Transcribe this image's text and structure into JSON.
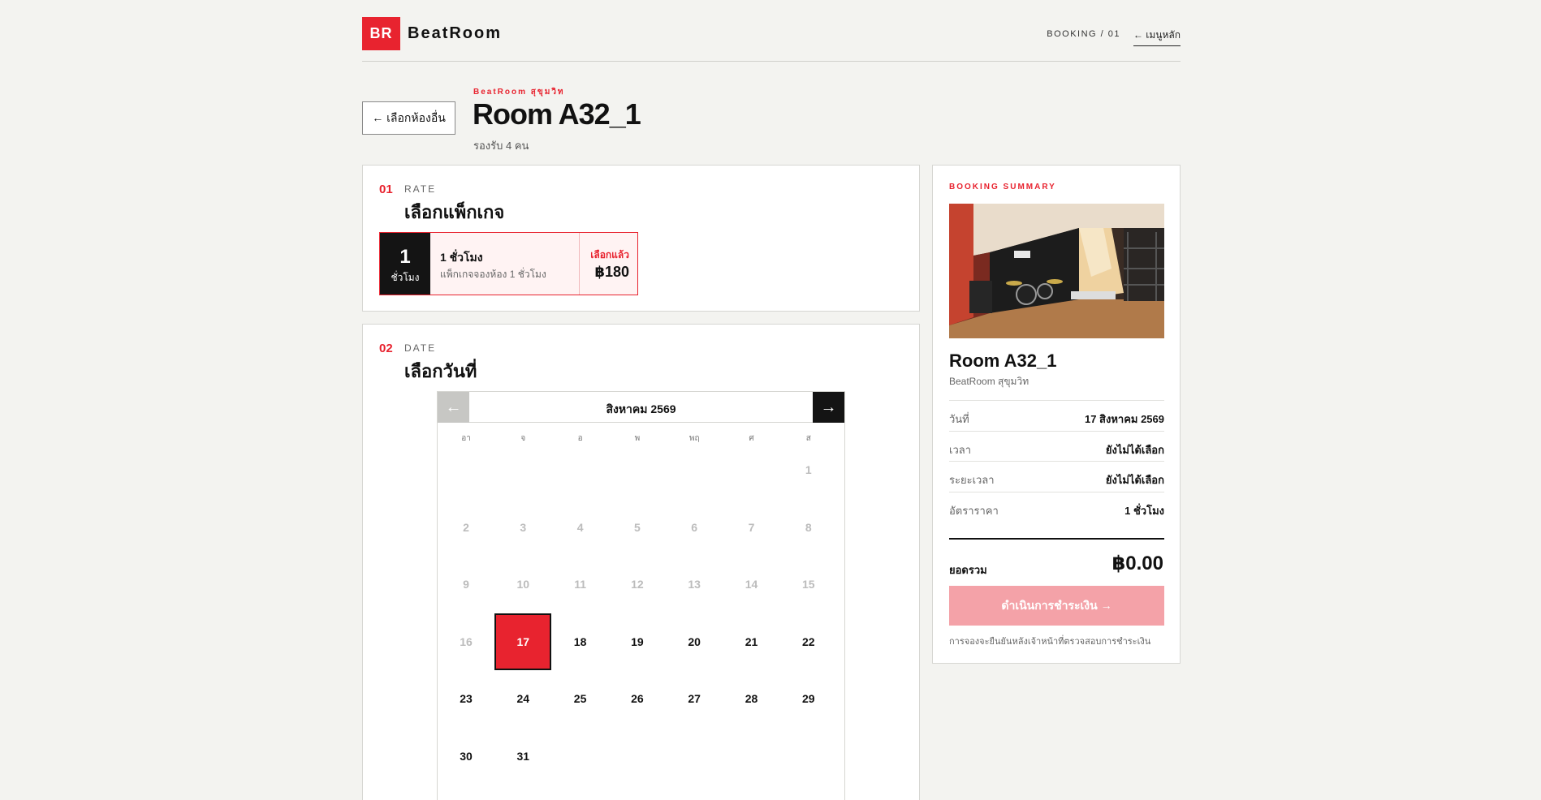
{
  "header": {
    "logo": "BR",
    "brand": "BeatRoom",
    "breadcrumb": "BOOKING / 01",
    "home_link": "← เมนูหลัก"
  },
  "room": {
    "back_button": "← เลือกห้องอื่น",
    "branch": "BeatRoom สุขุมวิท",
    "name": "Room A32_1",
    "capacity": "รองรับ 4 คน"
  },
  "rate_step": {
    "number": "01",
    "label_en": "RATE",
    "label_th": "เลือกแพ็กเกจ",
    "package": {
      "hours": "1",
      "unit": "ชั่วโมง",
      "name": "1 ชั่วโมง",
      "description": "แพ็กเกจจองห้อง 1 ชั่วโมง",
      "status": "เลือกแล้ว",
      "price": "฿180"
    }
  },
  "date_step": {
    "number": "02",
    "label_en": "DATE",
    "label_th": "เลือกวันที่",
    "prev": "←",
    "next": "→",
    "month": "สิงหาคม 2569",
    "weekdays": [
      "อา",
      "จ",
      "อ",
      "พ",
      "พฤ",
      "ศ",
      "ส"
    ],
    "first_weekday": 6,
    "days_in_month": 31,
    "disabled_until": 16,
    "selected_day": 17
  },
  "summary": {
    "label": "BOOKING SUMMARY",
    "room": "Room A32_1",
    "branch": "BeatRoom สุขุมวิท",
    "rows": [
      {
        "k": "วันที่",
        "v": "17 สิงหาคม 2569"
      },
      {
        "k": "เวลา",
        "v": "ยังไม่ได้เลือก"
      },
      {
        "k": "ระยะเวลา",
        "v": "ยังไม่ได้เลือก"
      },
      {
        "k": "อัตราราคา",
        "v": "1 ชั่วโมง"
      }
    ],
    "total_label": "ยอดรวม",
    "total": "฿0.00",
    "pay_button": "ดำเนินการชำระเงิน →",
    "note": "การจองจะยืนยันหลังเจ้าหน้าที่ตรวจสอบการชำระเงิน"
  },
  "colors": {
    "accent": "#e8232f",
    "dark": "#141414",
    "background": "#f3f3f0"
  }
}
